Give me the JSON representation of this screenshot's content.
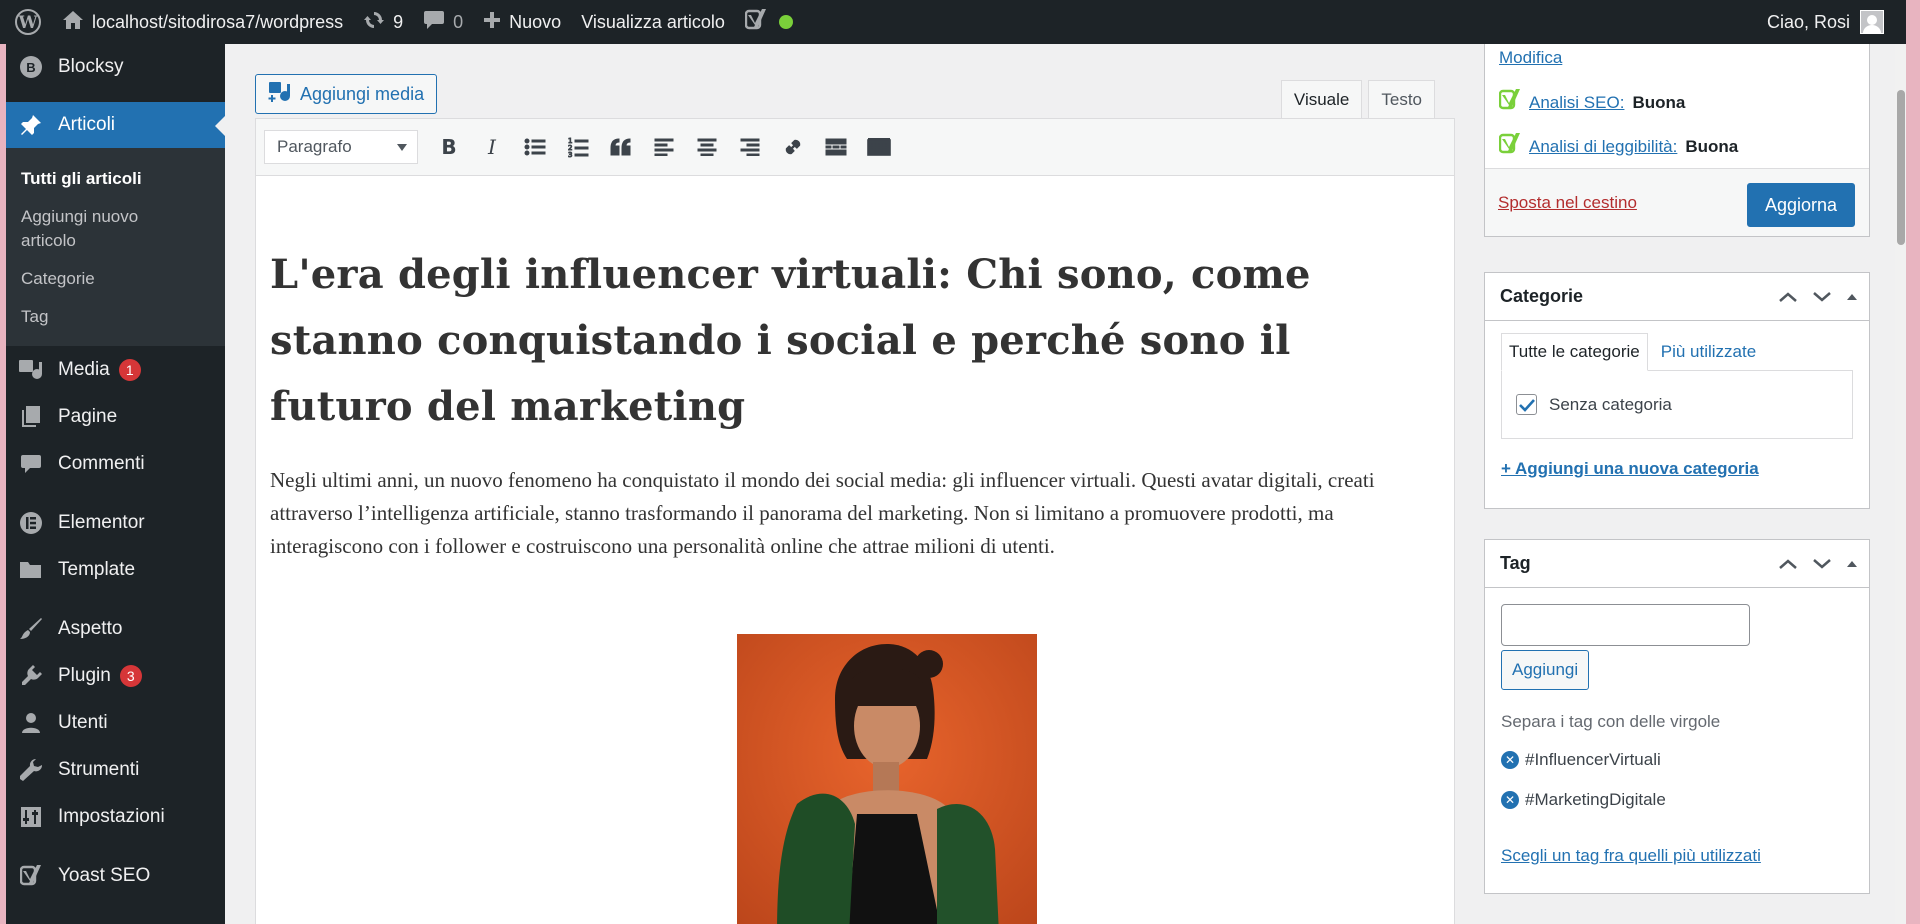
{
  "adminbar": {
    "site_url": "localhost/sitodirosa7/wordpress",
    "updates_count": "9",
    "comments_count": "0",
    "new_label": "Nuovo",
    "view_post": "Visualizza articolo",
    "greeting": "Ciao, Rosi"
  },
  "sidebar": {
    "blocksy": "Blocksy",
    "articoli": "Articoli",
    "submenu": [
      "Tutti gli articoli",
      "Aggiungi nuovo articolo",
      "Categorie",
      "Tag"
    ],
    "media": "Media",
    "media_badge": "1",
    "pagine": "Pagine",
    "commenti": "Commenti",
    "elementor": "Elementor",
    "template": "Template",
    "aspetto": "Aspetto",
    "plugin": "Plugin",
    "plugin_badge": "3",
    "utenti": "Utenti",
    "strumenti": "Strumenti",
    "impostazioni": "Impostazioni",
    "yoast": "Yoast SEO"
  },
  "editor": {
    "add_media": "Aggiungi media",
    "tab_visual": "Visuale",
    "tab_text": "Testo",
    "format_select": "Paragrafo",
    "title": "L'era degli influencer virtuali: Chi sono, come stanno conquistando i social e perché sono il futuro del marketing",
    "paragraph": "Negli ultimi anni, un nuovo fenomeno ha conquistato il mondo dei social media: gli influencer virtuali. Questi avatar digitali, creati attraverso l’intelligenza artificiale, stanno trasformando il panorama del marketing. Non si limitano a promuovere prodotti, ma interagiscono con i follower e costruiscono una personalità online che attrae milioni di utenti."
  },
  "publish": {
    "modify": "Modifica",
    "seo_label": "Analisi SEO:",
    "seo_value": "Buona",
    "read_label": "Analisi di leggibilità:",
    "read_value": "Buona",
    "trash": "Sposta nel cestino",
    "update": "Aggiorna"
  },
  "categories": {
    "title": "Categorie",
    "tab_all": "Tutte le categorie",
    "tab_used": "Più utilizzate",
    "item": "Senza categoria",
    "add_new": "+ Aggiungi una nuova categoria"
  },
  "tags": {
    "title": "Tag",
    "add_button": "Aggiungi",
    "hint": "Separa i tag con delle virgole",
    "items": [
      "#InfluencerVirtuali",
      "#MarketingDigitale"
    ],
    "choose": "Scegli un tag fra quelli più utilizzati"
  }
}
